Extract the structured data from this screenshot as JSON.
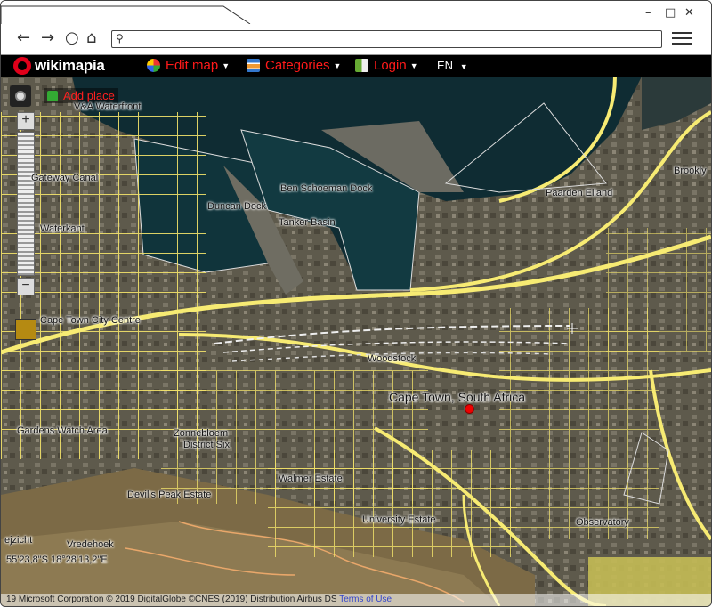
{
  "browser": {
    "window_controls": {
      "minimize": "–",
      "maximize": "□",
      "close": "✕"
    },
    "nav": {
      "back": "←",
      "forward": "→",
      "reload": "○",
      "home": "⌂"
    },
    "address_value": ""
  },
  "wikimapia": {
    "logo_text": "wikimapia",
    "menu": {
      "edit_map": "Edit map",
      "categories": "Categories",
      "login": "Login",
      "language": "EN"
    }
  },
  "map": {
    "add_place": "Add place",
    "zoom_in": "+",
    "zoom_out": "−",
    "labels": {
      "waterfront": "V&A Waterfront",
      "gateway_canal": "Gateway Canal",
      "ben_schoeman_dock": "Ben Schoeman Dock",
      "duncan_dock": "Duncan Dock",
      "tanker_basin": "Tanker Basin",
      "paarden_eiland": "Paarden Eiland",
      "brooklyn": "Brookly",
      "waterkant": "Waterkant",
      "cape_town_city_centre": "Cape Town City Centre",
      "woodstock": "Woodstock",
      "cape_town_south_africa": "Cape Town, South Africa",
      "gardens_watch_area": "Gardens Watch Area",
      "zonnebloem": "Zonnebloem",
      "district_six": "District Six",
      "walmer_estate": "Walmer Estate",
      "devils_peak_estate": "Devil's Peak Estate",
      "university_estate": "University Estate",
      "observatory": "Observatory",
      "vredehoek": "Vredehoek",
      "oranjezicht": "ejzicht"
    },
    "coordinates": "55'23,8\"S 18°28'13,2\"E",
    "copyright": "19 Microsoft Corporation © 2019 DigitalGlobe ©CNES (2019) Distribution Airbus DS",
    "terms": "Terms of Use"
  },
  "colors": {
    "brand_red": "#e0001a",
    "road_yellow": "#f3e36a",
    "sea": "#0f2c33"
  }
}
